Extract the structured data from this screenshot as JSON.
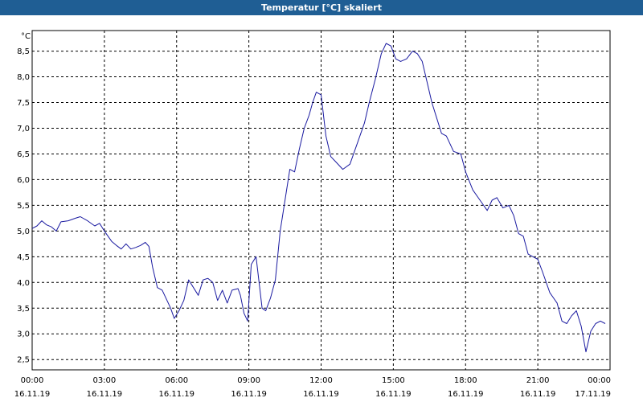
{
  "window": {
    "title": "Temperatur [°C] skaliert"
  },
  "chart_data": {
    "type": "line",
    "title": "Temperatur [°C] skaliert",
    "y_unit": "°C",
    "ylim": [
      2.3,
      8.9
    ],
    "yticks": [
      "2,5",
      "3,0",
      "3,5",
      "4,0",
      "4,5",
      "5,0",
      "5,5",
      "6,0",
      "6,5",
      "7,0",
      "7,5",
      "8,0",
      "8,5"
    ],
    "ytick_values": [
      2.5,
      3.0,
      3.5,
      4.0,
      4.5,
      5.0,
      5.5,
      6.0,
      6.5,
      7.0,
      7.5,
      8.0,
      8.5
    ],
    "xlim_hours": [
      0,
      24
    ],
    "xticks": [
      {
        "hour": 0,
        "time": "00:00",
        "date": "16.11.19"
      },
      {
        "hour": 3,
        "time": "03:00",
        "date": "16.11.19"
      },
      {
        "hour": 6,
        "time": "06:00",
        "date": "16.11.19"
      },
      {
        "hour": 9,
        "time": "09:00",
        "date": "16.11.19"
      },
      {
        "hour": 12,
        "time": "12:00",
        "date": "16.11.19"
      },
      {
        "hour": 15,
        "time": "15:00",
        "date": "16.11.19"
      },
      {
        "hour": 18,
        "time": "18:00",
        "date": "16.11.19"
      },
      {
        "hour": 21,
        "time": "21:00",
        "date": "16.11.19"
      },
      {
        "hour": 24,
        "time": "00:00",
        "date": "17.11.19"
      }
    ],
    "grid": true,
    "series": [
      {
        "color": "#1a1aa0",
        "x_hours": [
          0,
          0.2,
          0.4,
          0.6,
          0.8,
          1.0,
          1.2,
          1.5,
          1.8,
          2.0,
          2.3,
          2.6,
          2.8,
          3.0,
          3.3,
          3.5,
          3.7,
          3.9,
          4.1,
          4.3,
          4.5,
          4.7,
          4.85,
          5.0,
          5.2,
          5.4,
          5.6,
          5.75,
          5.9,
          6.1,
          6.3,
          6.5,
          6.7,
          6.9,
          7.1,
          7.3,
          7.5,
          7.7,
          7.9,
          8.1,
          8.3,
          8.55,
          8.65,
          8.8,
          8.95,
          9.1,
          9.3,
          9.55,
          9.7,
          9.9,
          10.1,
          10.3,
          10.5,
          10.7,
          10.9,
          11.1,
          11.3,
          11.5,
          11.65,
          11.8,
          12.0,
          12.2,
          12.4,
          12.6,
          12.9,
          13.2,
          13.5,
          13.8,
          14.0,
          14.25,
          14.5,
          14.7,
          14.9,
          15.1,
          15.3,
          15.55,
          15.8,
          16.0,
          16.2,
          16.4,
          16.6,
          16.8,
          17.0,
          17.2,
          17.5,
          17.8,
          18.0,
          18.3,
          18.6,
          18.9,
          19.1,
          19.3,
          19.55,
          19.8,
          20.0,
          20.2,
          20.4,
          20.6,
          20.8,
          21.0,
          21.2,
          21.5,
          21.65,
          21.8,
          22.0,
          22.2,
          22.4,
          22.6,
          22.8,
          23.0,
          23.2,
          23.4,
          23.6,
          23.8
        ],
        "values": [
          5.05,
          5.1,
          5.2,
          5.12,
          5.08,
          5.0,
          5.18,
          5.2,
          5.25,
          5.28,
          5.2,
          5.1,
          5.15,
          5.0,
          4.8,
          4.72,
          4.65,
          4.75,
          4.65,
          4.68,
          4.72,
          4.78,
          4.7,
          4.3,
          3.9,
          3.85,
          3.65,
          3.5,
          3.3,
          3.45,
          3.65,
          4.05,
          3.9,
          3.75,
          4.05,
          4.08,
          4.0,
          3.65,
          3.85,
          3.6,
          3.85,
          3.88,
          3.75,
          3.4,
          3.25,
          4.35,
          4.5,
          3.5,
          3.45,
          3.7,
          4.05,
          5.0,
          5.6,
          6.2,
          6.15,
          6.6,
          7.0,
          7.25,
          7.5,
          7.7,
          7.65,
          6.85,
          6.45,
          6.35,
          6.2,
          6.3,
          6.7,
          7.1,
          7.5,
          7.95,
          8.45,
          8.65,
          8.6,
          8.35,
          8.3,
          8.35,
          8.5,
          8.45,
          8.3,
          7.9,
          7.5,
          7.2,
          6.9,
          6.85,
          6.55,
          6.5,
          6.15,
          5.8,
          5.6,
          5.4,
          5.6,
          5.65,
          5.45,
          5.5,
          5.3,
          4.95,
          4.9,
          4.55,
          4.5,
          4.45,
          4.2,
          3.8,
          3.7,
          3.6,
          3.25,
          3.2,
          3.35,
          3.45,
          3.15,
          2.65,
          3.05,
          3.2,
          3.25,
          3.2
        ]
      }
    ]
  }
}
